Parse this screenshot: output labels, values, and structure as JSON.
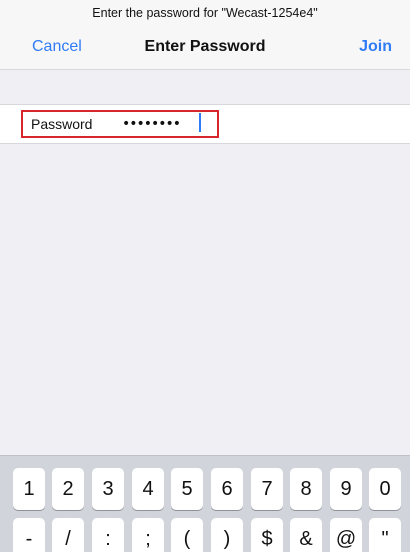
{
  "header": {
    "prompt": "Enter the password for \"Wecast-1254e4\"",
    "cancel_label": "Cancel",
    "title": "Enter Password",
    "join_label": "Join"
  },
  "password_field": {
    "label": "Password",
    "value": "••••••••"
  },
  "keyboard": {
    "row1": [
      "1",
      "2",
      "3",
      "4",
      "5",
      "6",
      "7",
      "8",
      "9",
      "0"
    ],
    "row2": [
      "-",
      "/",
      ":",
      ";",
      "(",
      ")",
      "$",
      "&",
      "@",
      "\""
    ]
  },
  "colors": {
    "accent": "#2f7cf6",
    "highlight": "#d7262e"
  }
}
